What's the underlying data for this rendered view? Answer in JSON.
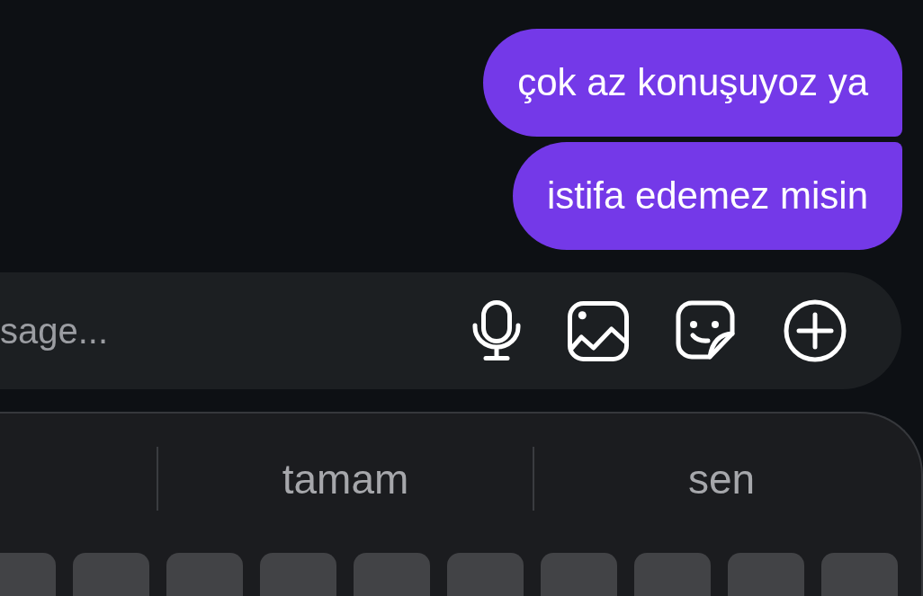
{
  "messages": [
    {
      "text": "çok az konuşuyoz ya",
      "kind": "sent"
    },
    {
      "text": "istifa edemez misin",
      "kind": "sent"
    }
  ],
  "composer": {
    "placeholder": "sage..."
  },
  "keyboard": {
    "suggestions": [
      "tamam",
      "sen"
    ]
  }
}
